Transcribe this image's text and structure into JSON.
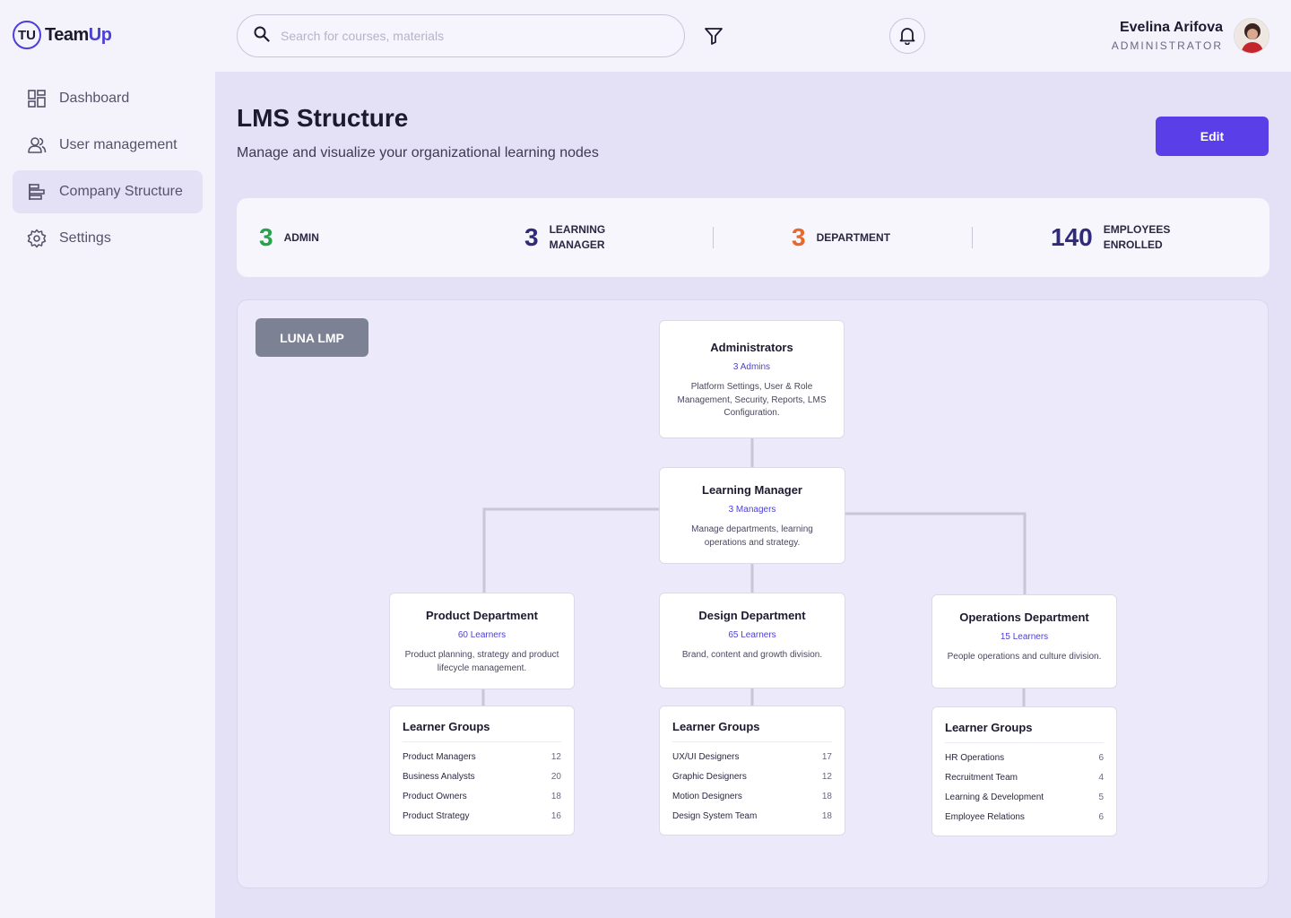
{
  "app": {
    "logo_mark": "TU",
    "logo_text_a": "Team",
    "logo_text_b": "Up",
    "accent": "#5a3ee8"
  },
  "search": {
    "placeholder": "Search for courses, materials"
  },
  "user": {
    "name": "Evelina Arifova",
    "role": "ADMINISTRATOR"
  },
  "sidebar": {
    "items": [
      {
        "label": "Dashboard",
        "icon": "dashboard-icon"
      },
      {
        "label": "User management",
        "icon": "users-icon"
      },
      {
        "label": "Company Structure",
        "icon": "structure-icon",
        "active": true
      },
      {
        "label": "Settings",
        "icon": "gear-icon"
      }
    ]
  },
  "page": {
    "title": "LMS Structure",
    "subtitle": "Manage and visualize your organizational learning nodes",
    "edit_label": "Edit"
  },
  "stats": [
    {
      "value": "3",
      "label_a": "ADMIN",
      "label_b": "",
      "color": "#27a34a"
    },
    {
      "value": "3",
      "label_a": "LEARNING",
      "label_b": "MANAGER",
      "color": "#2f2a7a"
    },
    {
      "value": "3",
      "label_a": "DEPARTMENT",
      "label_b": "",
      "color": "#e8672a"
    },
    {
      "value": "140",
      "label_a": "EMPLOYEES",
      "label_b": "ENROLLED",
      "color": "#2f2a7a"
    }
  ],
  "canvas": {
    "tag": "LUNA LMP",
    "admin": {
      "title": "Administrators",
      "count": "3 Admins",
      "desc": "Platform Settings, User & Role Management, Security, Reports, LMS Configuration."
    },
    "manager": {
      "title": "Learning Manager",
      "count": "3 Managers",
      "desc": "Manage departments, learning operations and strategy."
    },
    "departments": [
      {
        "title": "Product Department",
        "count": "60 Learners",
        "desc": "Product planning, strategy and product lifecycle management.",
        "groups_title": "Learner Groups",
        "groups": [
          {
            "name": "Product Managers",
            "count": "12"
          },
          {
            "name": "Business Analysts",
            "count": "20"
          },
          {
            "name": "Product Owners",
            "count": "18"
          },
          {
            "name": "Product Strategy",
            "count": "16"
          }
        ]
      },
      {
        "title": "Design Department",
        "count": "65 Learners",
        "desc": "Brand, content and growth division.",
        "groups_title": "Learner Groups",
        "groups": [
          {
            "name": "UX/UI Designers",
            "count": "17"
          },
          {
            "name": "Graphic Designers",
            "count": "12"
          },
          {
            "name": "Motion Designers",
            "count": "18"
          },
          {
            "name": "Design System Team",
            "count": "18"
          }
        ]
      },
      {
        "title": "Operations Department",
        "count": "15 Learners",
        "desc": "People operations and culture division.",
        "groups_title": "Learner Groups",
        "groups": [
          {
            "name": "HR Operations",
            "count": "6"
          },
          {
            "name": "Recruitment Team",
            "count": "4"
          },
          {
            "name": "Learning & Development",
            "count": "5"
          },
          {
            "name": "Employee Relations",
            "count": "6"
          }
        ]
      }
    ]
  }
}
